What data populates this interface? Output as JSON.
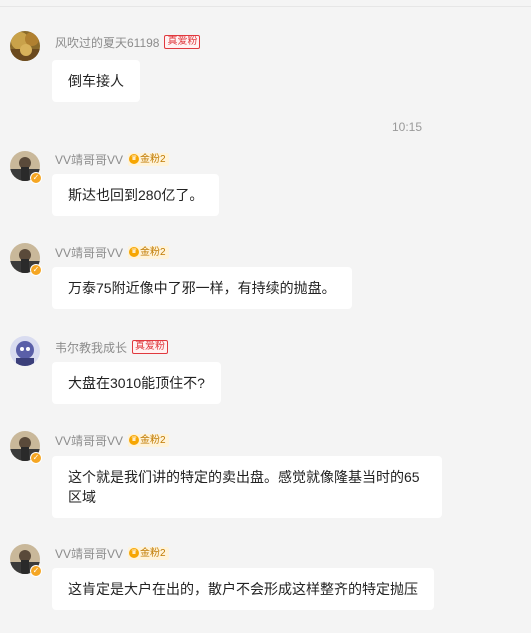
{
  "messages": [
    {
      "nickname": "风吹过的夏天61198",
      "badge_type": "fan",
      "badge": "真爱粉",
      "text": "倒车接人",
      "avatar": "autumn-photo-avatar"
    },
    {
      "nickname": "VV靖哥哥VV",
      "badge_type": "gold",
      "badge": "金粉2",
      "text": "斯达也回到280亿了。",
      "avatar": "portrait-avatar"
    },
    {
      "nickname": "VV靖哥哥VV",
      "badge_type": "gold",
      "badge": "金粉2",
      "text": "万泰75附近像中了邪一样，有持续的抛盘。",
      "avatar": "portrait-avatar"
    },
    {
      "nickname": "韦尔教我成长",
      "badge_type": "fan",
      "badge": "真爱粉",
      "text": "大盘在3010能顶住不?",
      "avatar": "cartoon-avatar"
    },
    {
      "nickname": "VV靖哥哥VV",
      "badge_type": "gold",
      "badge": "金粉2",
      "text_line1": "这个就是我们讲的特定的卖出盘。感觉就像隆基当时的65",
      "text_line2": "区域",
      "avatar": "portrait-avatar"
    },
    {
      "nickname": "VV靖哥哥VV",
      "badge_type": "gold",
      "badge": "金粉2",
      "text": "这肯定是大户在出的，散户不会形成这样整齐的特定抛压",
      "avatar": "portrait-avatar"
    }
  ],
  "timestamp": "10:15",
  "colors": {
    "background": "#f4f4f4",
    "bubble": "#ffffff",
    "nickname": "#8c8c8c",
    "fan_badge": "#e0393e",
    "gold_badge": "#f7a600"
  }
}
